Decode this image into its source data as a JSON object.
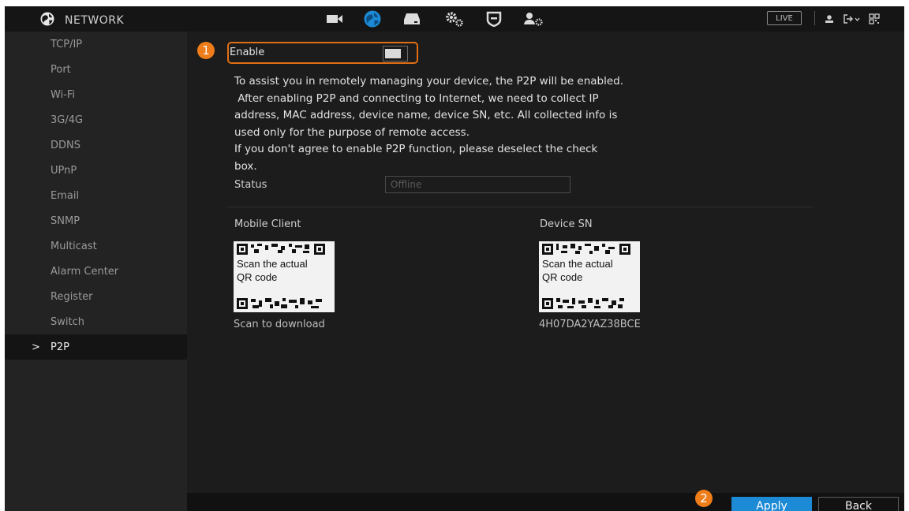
{
  "header": {
    "title": "NETWORK",
    "logo_icon": "network-globe-icon",
    "nav_icons": [
      "camera-icon",
      "network-globe-icon",
      "storage-icon",
      "system-gears-icon",
      "security-shield-icon",
      "account-icon"
    ],
    "live_label": "LIVE",
    "right_icons": [
      "user-icon",
      "logout-icon",
      "qr-grid-icon"
    ],
    "colors": {
      "accent": "#1d8ad6",
      "callout": "#ef7d1a",
      "background": "#1c1c1c"
    }
  },
  "sidebar": {
    "items": [
      {
        "label": "TCP/IP"
      },
      {
        "label": "Port"
      },
      {
        "label": "Wi-Fi"
      },
      {
        "label": "3G/4G"
      },
      {
        "label": "DDNS"
      },
      {
        "label": "UPnP"
      },
      {
        "label": "Email"
      },
      {
        "label": "SNMP"
      },
      {
        "label": "Multicast"
      },
      {
        "label": "Alarm Center"
      },
      {
        "label": "Register"
      },
      {
        "label": "Switch"
      },
      {
        "label": "P2P",
        "active": true,
        "marker": ">"
      }
    ]
  },
  "main": {
    "callout_1": "1",
    "callout_2": "2",
    "enable_label": "Enable",
    "enable_checked": true,
    "notice_lines": [
      "To assist you in remotely managing your device, the P2P will be enabled.",
      " After enabling P2P and connecting to Internet, we need to collect IP",
      "address, MAC address, device name, device SN, etc. All collected info is",
      "used only for the purpose of remote access.",
      "If you don't agree to enable P2P function, please deselect the check",
      "box."
    ],
    "status_label": "Status",
    "status_value": "Offline",
    "mobile_client_label": "Mobile Client",
    "device_sn_label": "Device SN",
    "qr_text_line1": "Scan the actual",
    "qr_text_line2": "QR code",
    "scan_download_label": "Scan to download",
    "device_sn_value": "4H07DA2YAZ38BCE"
  },
  "footer": {
    "apply_label": "Apply",
    "back_label": "Back"
  }
}
